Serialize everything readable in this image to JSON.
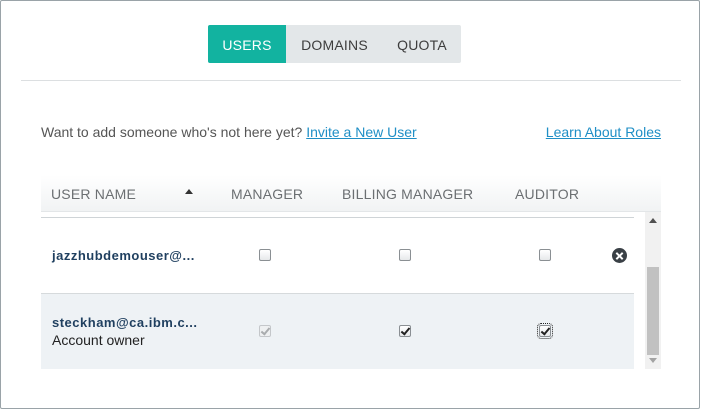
{
  "tabs": [
    {
      "label": "USERS",
      "active": true
    },
    {
      "label": "DOMAINS",
      "active": false
    },
    {
      "label": "QUOTA",
      "active": false
    }
  ],
  "invite": {
    "prompt": "Want to add someone who's not here yet?",
    "link_label": "Invite a New User"
  },
  "learn_roles_label": "Learn About Roles",
  "table": {
    "columns": [
      "USER NAME",
      "MANAGER",
      "BILLING MANAGER",
      "AUDITOR"
    ],
    "sort": {
      "column": "USER NAME",
      "direction": "ascending"
    },
    "rows": [
      {
        "user": "jazzhubdemouser@...",
        "subtitle": "",
        "manager": false,
        "billing_manager": false,
        "auditor": false,
        "removable": true
      },
      {
        "user": "steckham@ca.ibm.c...",
        "subtitle": "Account owner",
        "manager": true,
        "manager_disabled": true,
        "billing_manager": true,
        "auditor": true,
        "removable": false
      }
    ]
  },
  "colors": {
    "accent": "#12b3a0",
    "link": "#1f8fc6",
    "username": "#1f3f5f"
  },
  "icons": {
    "remove": "close-circle-icon",
    "sort": "sort-ascending-icon"
  }
}
